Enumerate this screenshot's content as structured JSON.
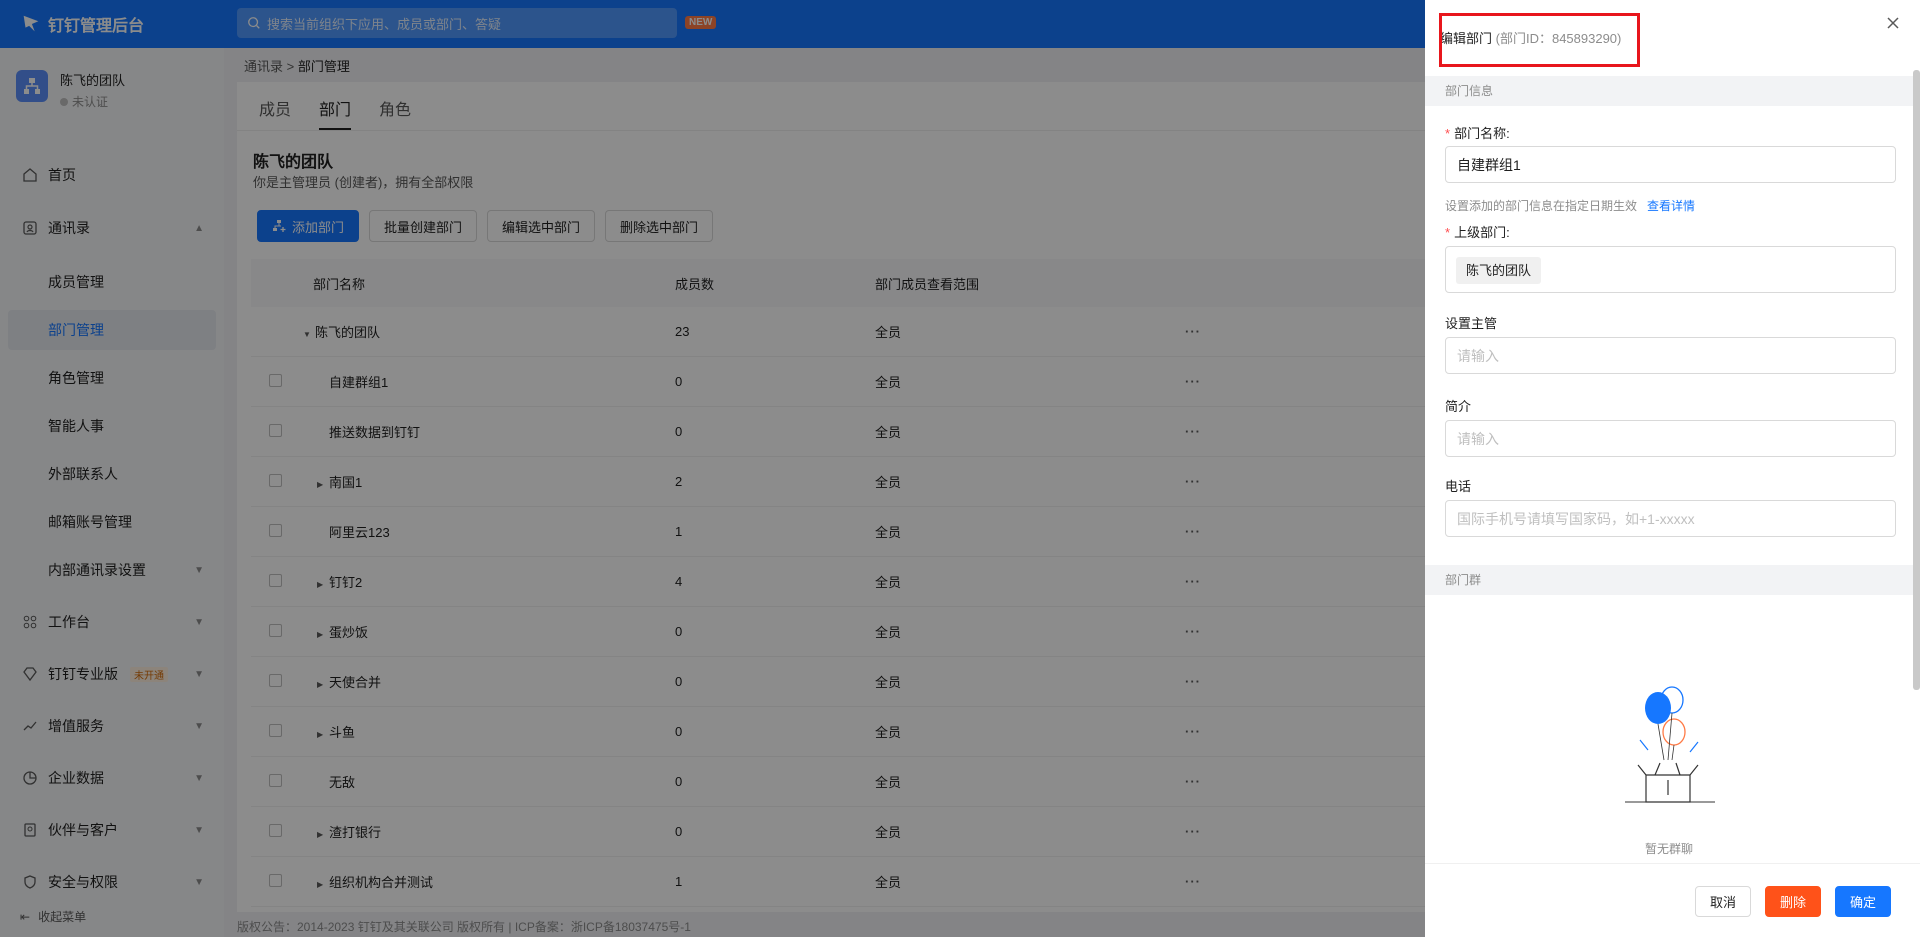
{
  "app": {
    "title": "钉钉管理后台",
    "new_badge": "NEW"
  },
  "search": {
    "placeholder": "搜索当前组织下应用、成员或部门、答疑"
  },
  "org": {
    "name": "陈飞的团队",
    "status": "未认证"
  },
  "sidebar": {
    "items": [
      {
        "label": "首页",
        "icon": "home-icon"
      },
      {
        "label": "通讯录",
        "icon": "contacts-icon"
      },
      {
        "label": "成员管理"
      },
      {
        "label": "部门管理"
      },
      {
        "label": "角色管理"
      },
      {
        "label": "智能人事"
      },
      {
        "label": "外部联系人"
      },
      {
        "label": "邮箱账号管理"
      },
      {
        "label": "内部通讯录设置"
      },
      {
        "label": "工作台",
        "icon": "apps-icon"
      },
      {
        "label": "钉钉专业版",
        "icon": "diamond-icon",
        "tag": "未开通"
      },
      {
        "label": "增值服务",
        "icon": "chart-trend-icon"
      },
      {
        "label": "企业数据",
        "icon": "data-icon"
      },
      {
        "label": "伙伴与客户",
        "icon": "partner-icon"
      },
      {
        "label": "安全与权限",
        "icon": "shield-icon"
      }
    ],
    "collapse_label": "收起菜单"
  },
  "breadcrumb": {
    "parent": "通讯录",
    "separator": ">",
    "current": "部门管理"
  },
  "tabs": [
    "成员",
    "部门",
    "角色"
  ],
  "team": {
    "title": "陈飞的团队",
    "subtitle": "你是主管理员 (创建者)，拥有全部权限"
  },
  "actions": [
    "添加部门",
    "批量创建部门",
    "编辑选中部门",
    "删除选中部门"
  ],
  "table": {
    "headers": [
      "部门名称",
      "成员数",
      "部门成员查看范围"
    ],
    "rows": [
      {
        "name": "陈飞的团队",
        "count": "23",
        "scope": "全员",
        "more": "···"
      },
      {
        "name": "自建群组1",
        "count": "0",
        "scope": "全员",
        "more": "···"
      },
      {
        "name": "推送数据到钉钉",
        "count": "0",
        "scope": "全员",
        "more": "···"
      },
      {
        "name": "南国1",
        "count": "2",
        "scope": "全员",
        "more": "···"
      },
      {
        "name": "阿里云123",
        "count": "1",
        "scope": "全员",
        "more": "···"
      },
      {
        "name": "钉钉2",
        "count": "4",
        "scope": "全员",
        "more": "···"
      },
      {
        "name": "蛋炒饭",
        "count": "0",
        "scope": "全员",
        "more": "···"
      },
      {
        "name": "天使合并",
        "count": "0",
        "scope": "全员",
        "more": "···"
      },
      {
        "name": "斗鱼",
        "count": "0",
        "scope": "全员",
        "more": "···"
      },
      {
        "name": "无敌",
        "count": "0",
        "scope": "全员",
        "more": "···"
      },
      {
        "name": "渣打银行",
        "count": "0",
        "scope": "全员",
        "more": "···"
      },
      {
        "name": "组织机构合并测试",
        "count": "1",
        "scope": "全员",
        "more": "···"
      }
    ]
  },
  "footer": "版权公告：2014-2023 钉钉及其关联公司 版权所有 | ICP备案：浙ICP备18037475号-1",
  "drawer": {
    "title": "编辑部门",
    "dept_id": "(部门ID：845893290)",
    "section_info": "部门信息",
    "name_label": "部门名称:",
    "name_value": "自建群组1",
    "hint": "设置添加的部门信息在指定日期生效",
    "hint_link": "查看详情",
    "parent_label": "上级部门:",
    "parent_value": "陈飞的团队",
    "manager_label": "设置主管",
    "manager_placeholder": "请输入",
    "intro_label": "简介",
    "intro_placeholder": "请输入",
    "phone_label": "电话",
    "phone_placeholder": "国际手机号请填写国家码，如+1-xxxxx",
    "section_group": "部门群",
    "empty_text": "暂无群聊",
    "cancel": "取消",
    "delete": "删除",
    "confirm": "确定"
  },
  "colors": {
    "primary": "#1677ff",
    "danger": "#ff5219",
    "highlight": "#e8161c"
  }
}
